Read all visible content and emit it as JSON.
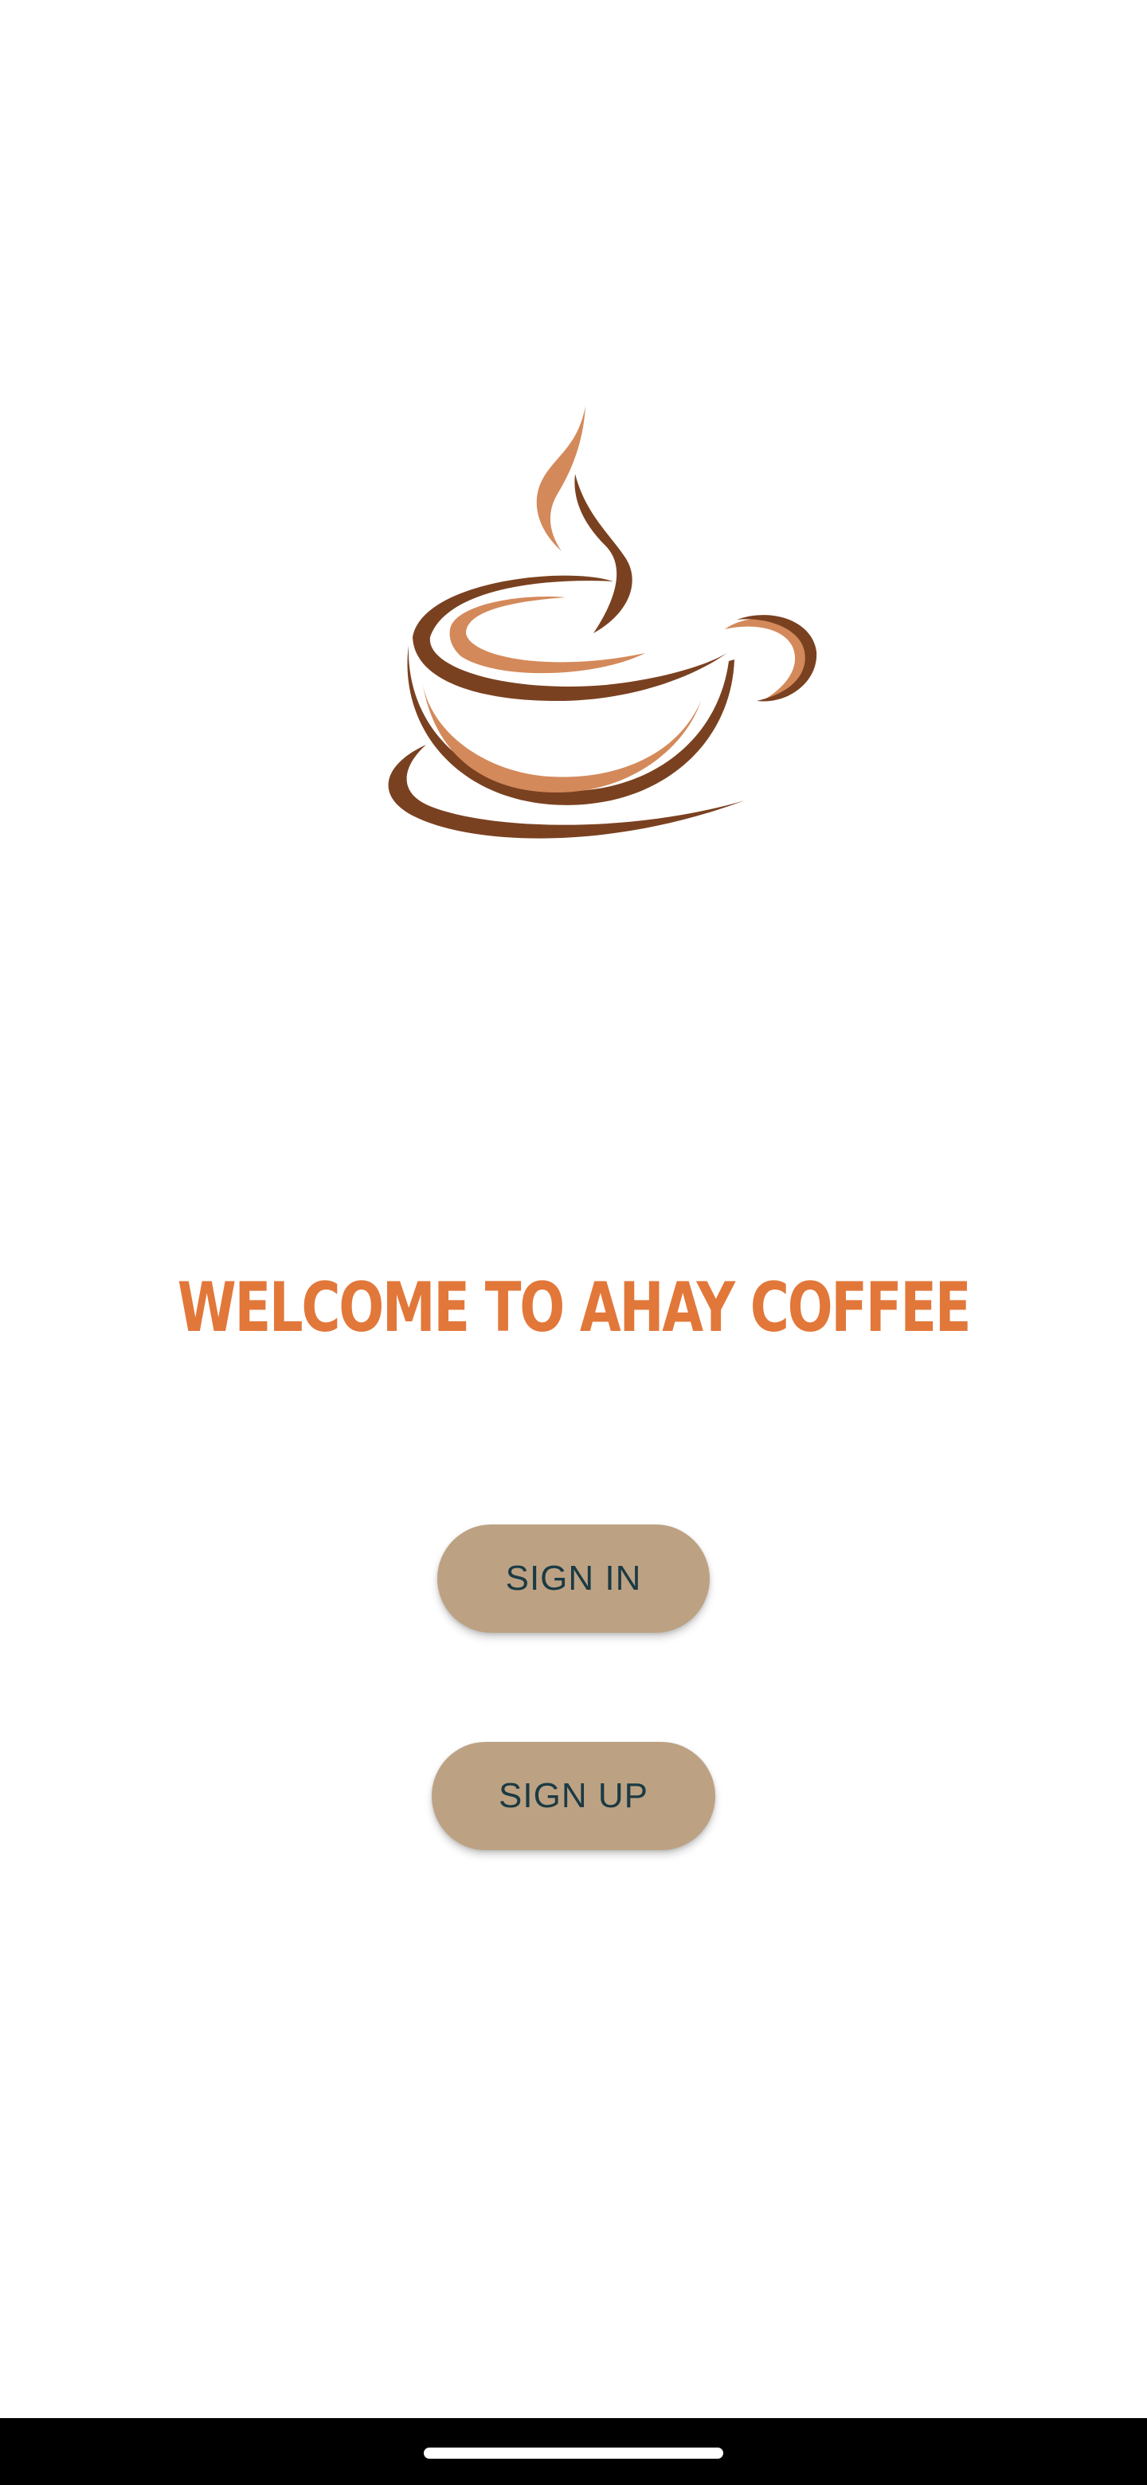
{
  "app": {
    "logo_icon": "coffee-cup-logo-icon",
    "colors": {
      "title": "#E2773A",
      "button_bg": "#BCA283",
      "button_text": "#1B3A44",
      "logo_dark": "#7A4120",
      "logo_light": "#D4895A"
    }
  },
  "welcome": {
    "title": "WELCOME TO AHAY COFFEE"
  },
  "actions": {
    "sign_in_label": "SIGN IN",
    "sign_up_label": "SIGN UP"
  },
  "system": {
    "nav_handle_icon": "home-gesture-handle"
  }
}
